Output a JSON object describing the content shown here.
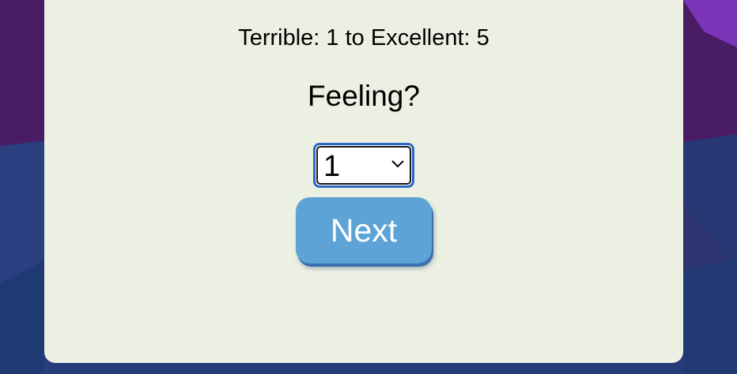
{
  "survey": {
    "scale_hint": "Terrible: 1 to Excellent: 5",
    "question": "Feeling?",
    "selected_value": "1",
    "next_label": "Next"
  },
  "colors": {
    "card_background": "#ebf0e3",
    "button_background": "#5ea3d6",
    "select_focus_border": "#2f66c9",
    "wallpaper_purple": "#4a1c66",
    "wallpaper_blue": "#253a78"
  },
  "icons": {
    "dropdown": "chevron-down-icon"
  }
}
